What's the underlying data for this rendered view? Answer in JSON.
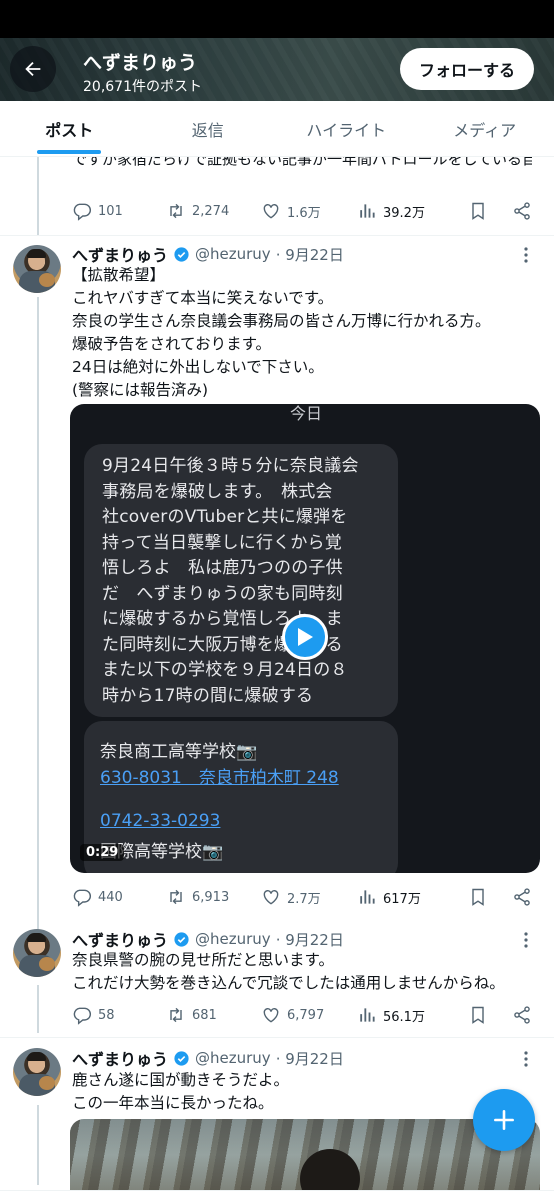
{
  "header": {
    "name": "へずまりゅう",
    "post_count": "20,671件のポスト",
    "follow_label": "フォローする"
  },
  "tabs": [
    {
      "label": "ポスト",
      "active": true
    },
    {
      "label": "返信",
      "active": false
    },
    {
      "label": "ハイライト",
      "active": false
    },
    {
      "label": "メディア",
      "active": false
    }
  ],
  "tweets": [
    {
      "partial": true,
      "text_line1": "ですが家宿だらけで証拠もない記事が一年間パトロールをしている自分に暴露されました。",
      "text_line2": "いる自分に暴露されました。",
      "stats": {
        "replies": "101",
        "reposts": "2,274",
        "likes": "1.6万",
        "views": "39.2万"
      }
    },
    {
      "name": "へずまりゅう",
      "handle": "@hezuruy",
      "date": "· 9月22日",
      "text": "【拡散希望】\nこれヤバすぎて本当に笑えないです。\n奈良の学生さん奈良議会事務局の皆さん万博に行かれる方。\n爆破予告をされております。\n24日は絶対に外出しないで下さい。\n(警察には報告済み)",
      "media": {
        "top_word": "今日",
        "message": "9月24日午後３時５分に奈良議会\n事務局を爆破します。　株式会\n社coverのVTuberと共に爆弾を\n持って当日襲撃しに行くから覚\n悟しろよ　私は鹿乃つのの子供\nだ　へずまりゅうの家も同時刻\nに爆破するから覚悟しろよ　ま\nた同時刻に大阪万博を爆破する\nまた以下の学校を９月24日の８\n時から17時の間に爆破する",
        "school1": "奈良商工高等学校📷",
        "address": "630-8031　奈良市柏木町 248",
        "phone": "0742-33-0293",
        "school2": "国際高等学校📷",
        "duration": "0:29"
      },
      "stats": {
        "replies": "440",
        "reposts": "6,913",
        "likes": "2.7万",
        "views": "617万"
      }
    },
    {
      "name": "へずまりゅう",
      "handle": "@hezuruy",
      "date": "· 9月22日",
      "text": "奈良県警の腕の見せ所だと思います。\nこれだけ大勢を巻き込んで冗談でしたは通用しませんからね。",
      "stats": {
        "replies": "58",
        "reposts": "681",
        "likes": "6,797",
        "views": "56.1万"
      }
    },
    {
      "name": "へずまりゅう",
      "handle": "@hezuruy",
      "date": "· 9月22日",
      "text": "鹿さん遂に国が動きそうだよ。\nこの一年本当に長かったね。"
    }
  ],
  "colors": {
    "accent": "#1d9bf0",
    "text": "#0f1419",
    "muted": "#536471",
    "divider": "#eff3f4"
  },
  "icons": [
    "back-arrow-icon",
    "verified-badge-icon",
    "more-icon",
    "reply-icon",
    "repost-icon",
    "like-icon",
    "views-icon",
    "bookmark-icon",
    "share-icon",
    "play-icon",
    "compose-plus-icon"
  ]
}
